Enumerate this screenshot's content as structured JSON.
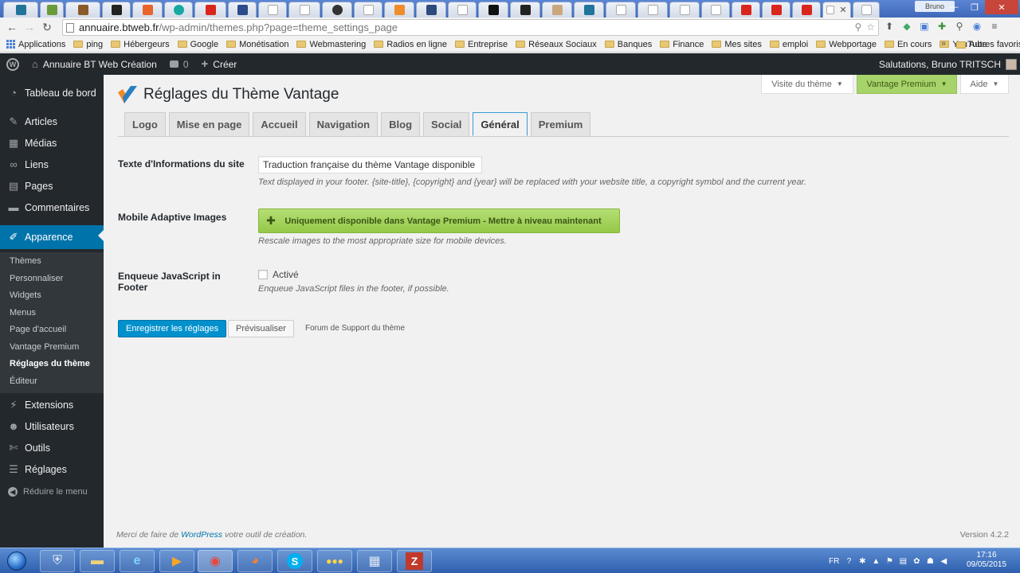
{
  "browser": {
    "user_badge": "Bruno",
    "url_host": "annuaire.btweb.fr",
    "url_path": "/wp-admin/themes.php?page=theme_settings_page"
  },
  "bookmarks": {
    "items": [
      "Applications",
      "ping",
      "Hébergeurs",
      "Google",
      "Monétisation",
      "Webmastering",
      "Radios en ligne",
      "Entreprise",
      "Réseaux Sociaux",
      "Banques",
      "Finance",
      "Mes sites",
      "emploi",
      "Webportage",
      "En cours",
      "YouTube"
    ],
    "more": "»",
    "other": "Autres favoris"
  },
  "adminbar": {
    "site_name": "Annuaire BT Web Création",
    "comments_count": "0",
    "new_label": "Créer",
    "greeting": "Salutations, Bruno TRITSCH"
  },
  "sidebar": {
    "items": [
      {
        "label": "Tableau de bord",
        "icon": "dashboard-icon"
      },
      {
        "label": "Articles",
        "icon": "pin-icon"
      },
      {
        "label": "Médias",
        "icon": "media-icon"
      },
      {
        "label": "Liens",
        "icon": "link-icon"
      },
      {
        "label": "Pages",
        "icon": "page-icon"
      },
      {
        "label": "Commentaires",
        "icon": "comment-icon"
      },
      {
        "label": "Apparence",
        "icon": "brush-icon"
      },
      {
        "label": "Extensions",
        "icon": "plugin-icon"
      },
      {
        "label": "Utilisateurs",
        "icon": "users-icon"
      },
      {
        "label": "Outils",
        "icon": "wrench-icon"
      },
      {
        "label": "Réglages",
        "icon": "settings-icon"
      }
    ],
    "submenu": [
      "Thèmes",
      "Personnaliser",
      "Widgets",
      "Menus",
      "Page d'accueil",
      "Vantage Premium",
      "Réglages du thème",
      "Éditeur"
    ],
    "collapse": "Réduire le menu"
  },
  "screen_meta": {
    "visit": "Visite du thème",
    "premium": "Vantage Premium",
    "help": "Aide"
  },
  "page": {
    "title": "Réglages du Thème Vantage",
    "tabs": [
      "Logo",
      "Mise en page",
      "Accueil",
      "Navigation",
      "Blog",
      "Social",
      "Général",
      "Premium"
    ],
    "active_tab": "Général"
  },
  "fields": {
    "site_info_label": "Texte d'Informations du site",
    "site_info_value": "Traduction française du thème Vantage disponible s",
    "site_info_desc": "Text displayed in your footer. {site-title}, {copyright} and {year} will be replaced with your website title, a copyright symbol and the current year.",
    "mobile_label": "Mobile Adaptive Images",
    "mobile_button": "Uniquement disponible dans Vantage Premium - Mettre à niveau maintenant",
    "mobile_desc": "Rescale images to the most appropriate size for mobile devices.",
    "js_label": "Enqueue JavaScript in Footer",
    "js_checkbox": "Activé",
    "js_desc": "Enqueue JavaScript files in the footer, if possible."
  },
  "actions": {
    "save": "Enregistrer les réglages",
    "preview": "Prévisualiser",
    "support": "Forum de Support du thème"
  },
  "footer": {
    "thanks_prefix": "Merci de faire de",
    "thanks_link": "WordPress",
    "thanks_suffix": "votre outil de création.",
    "version": "Version 4.2.2"
  },
  "taskbar": {
    "lang": "FR",
    "time": "17:16",
    "date": "09/05/2015"
  },
  "colors": {
    "wp_admin_dark": "#23282d",
    "wp_blue": "#0073aa",
    "premium_green": "#a6d36a"
  }
}
